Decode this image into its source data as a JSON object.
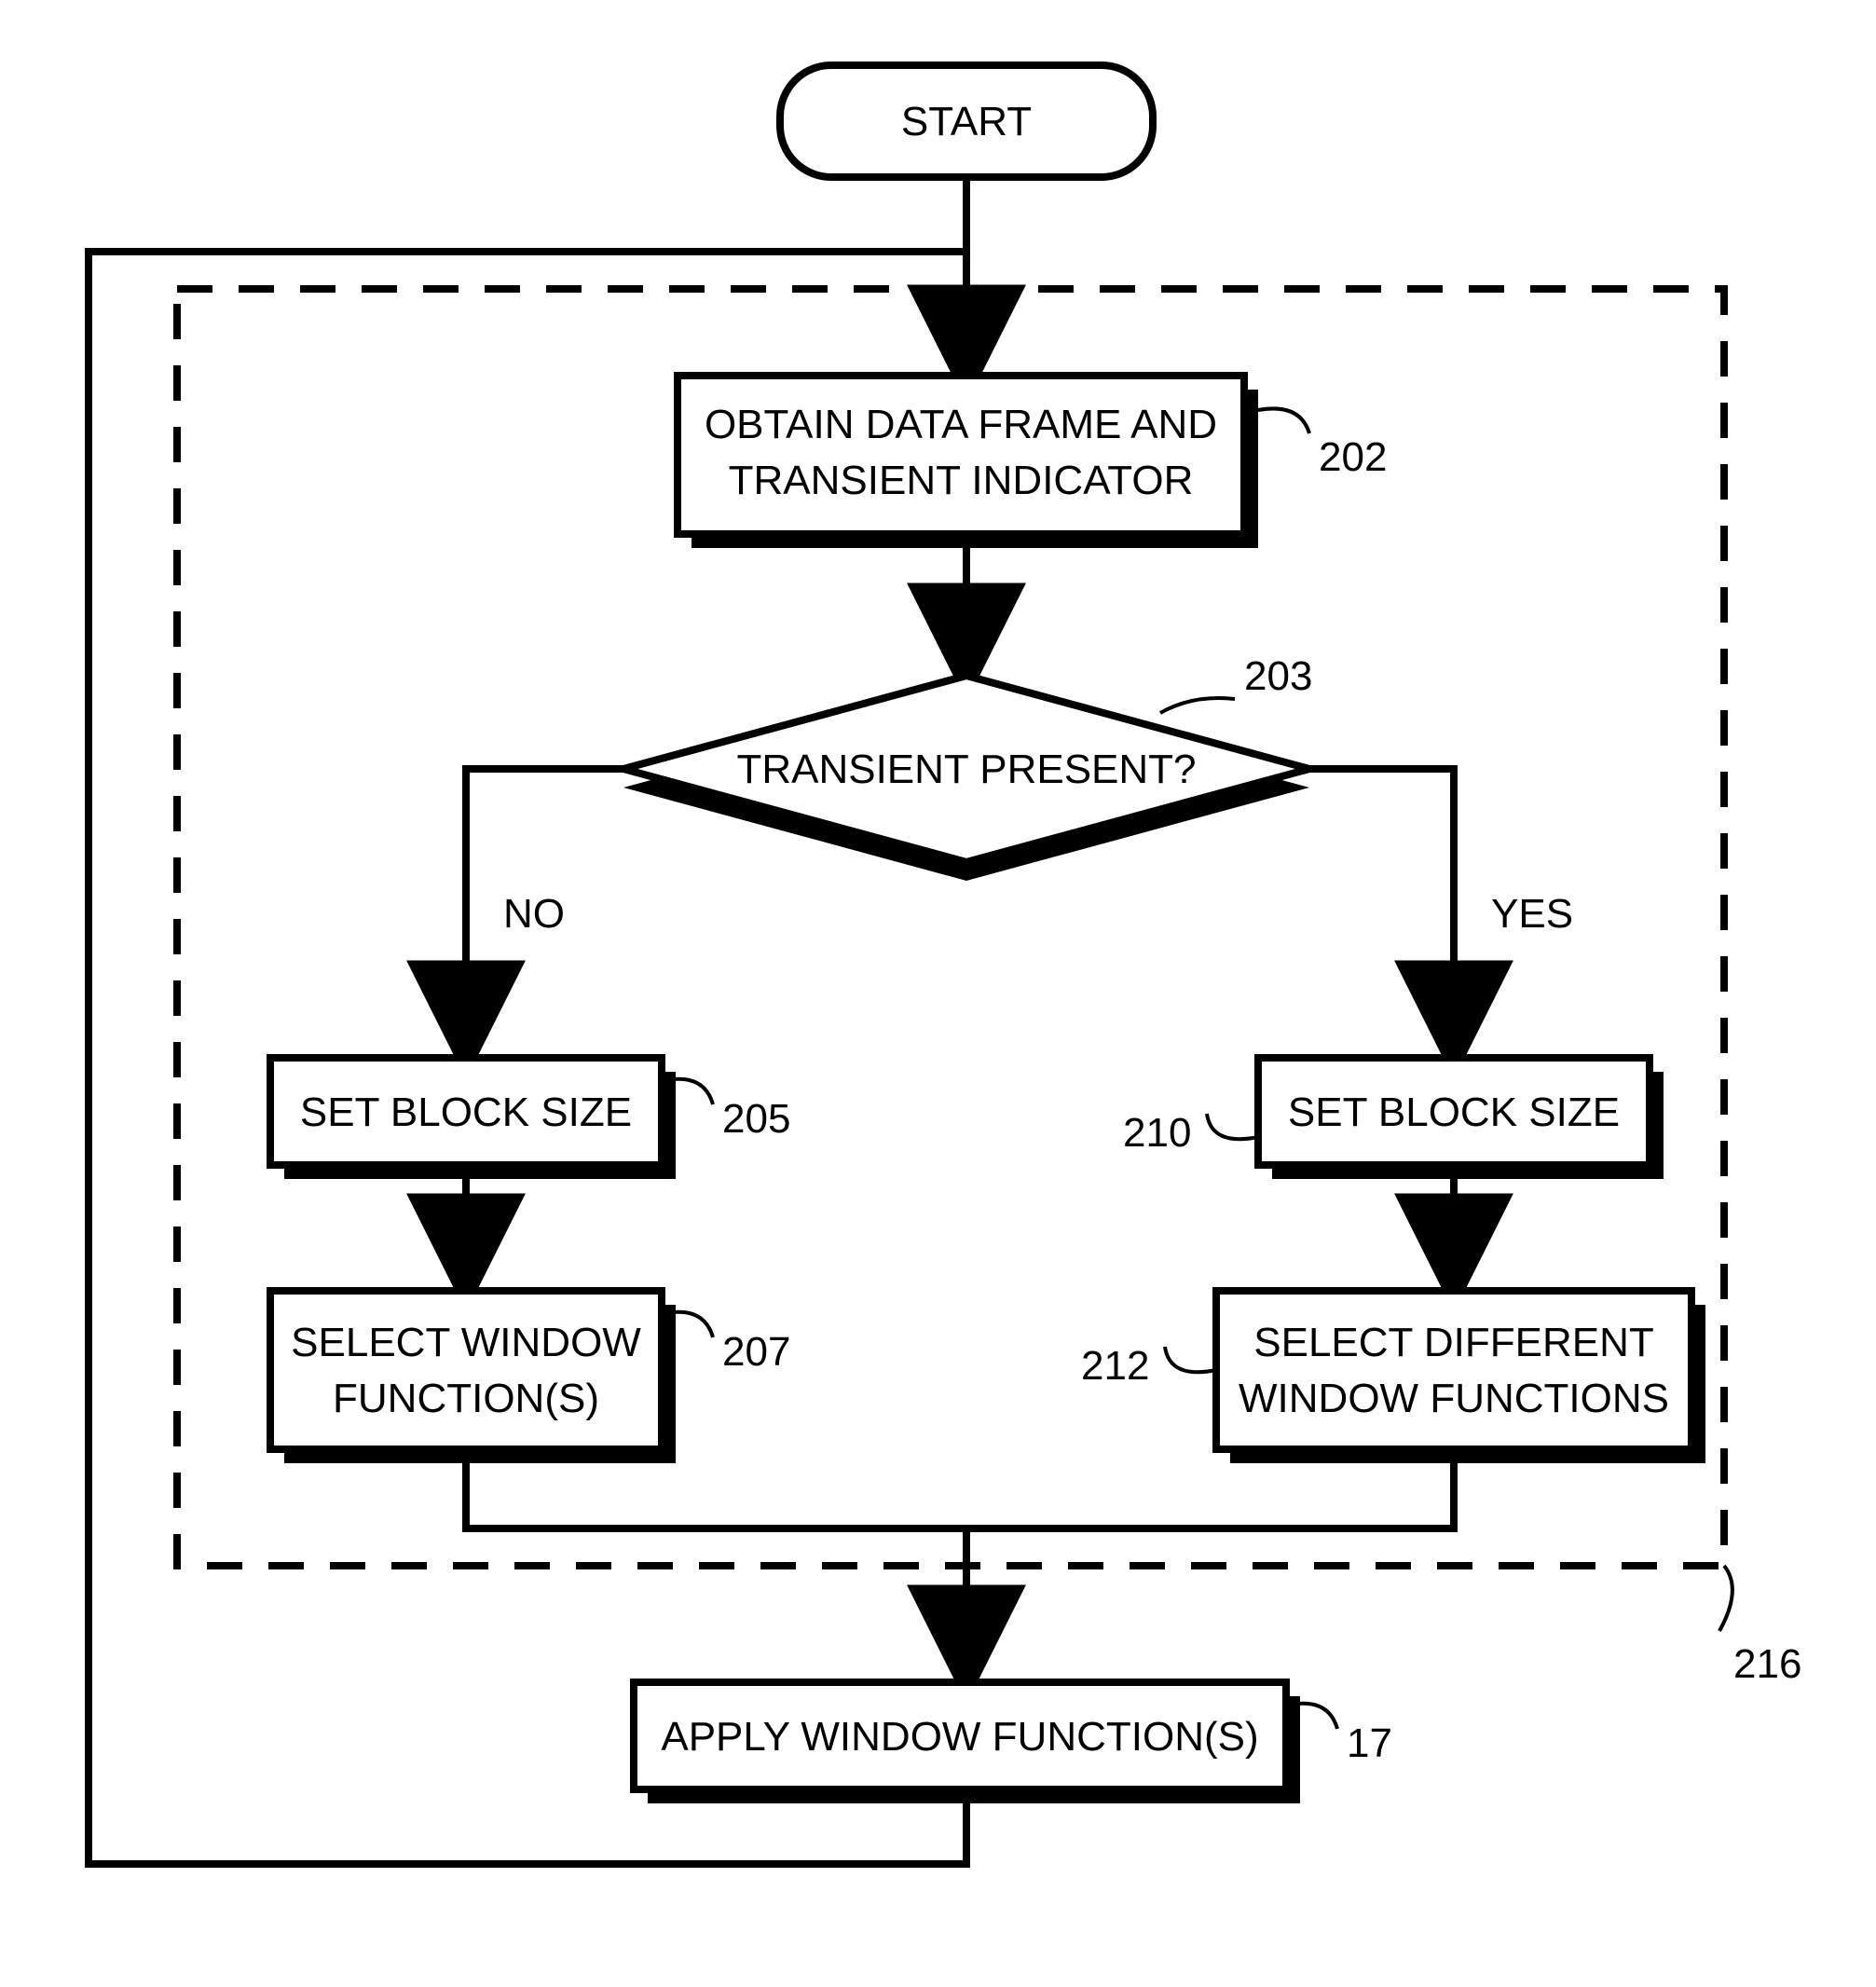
{
  "chart_data": {
    "type": "flowchart",
    "nodes": [
      {
        "id": "start",
        "shape": "terminator",
        "text": "START"
      },
      {
        "id": "n202",
        "shape": "process",
        "text_lines": [
          "OBTAIN DATA FRAME AND",
          "TRANSIENT INDICATOR"
        ],
        "label": "202"
      },
      {
        "id": "n203",
        "shape": "decision",
        "text": "TRANSIENT PRESENT?",
        "label": "203"
      },
      {
        "id": "n205",
        "shape": "process",
        "text": "SET BLOCK SIZE",
        "label": "205"
      },
      {
        "id": "n207",
        "shape": "process",
        "text_lines": [
          "SELECT WINDOW",
          "FUNCTION(S)"
        ],
        "label": "207"
      },
      {
        "id": "n210",
        "shape": "process",
        "text": "SET BLOCK SIZE",
        "label": "210"
      },
      {
        "id": "n212",
        "shape": "process",
        "text_lines": [
          "SELECT DIFFERENT",
          "WINDOW FUNCTIONS"
        ],
        "label": "212"
      },
      {
        "id": "n17",
        "shape": "process",
        "text": "APPLY WINDOW FUNCTION(S)",
        "label": "17"
      }
    ],
    "edges": [
      {
        "from": "start",
        "to": "n202"
      },
      {
        "from": "n202",
        "to": "n203"
      },
      {
        "from": "n203",
        "to": "n205",
        "label": "NO"
      },
      {
        "from": "n203",
        "to": "n210",
        "label": "YES"
      },
      {
        "from": "n205",
        "to": "n207"
      },
      {
        "from": "n210",
        "to": "n212"
      },
      {
        "from": "n207",
        "to": "n17"
      },
      {
        "from": "n212",
        "to": "n17"
      },
      {
        "from": "n17",
        "to": "n202",
        "note": "loop back"
      }
    ],
    "group": {
      "label": "216",
      "members": [
        "n202",
        "n203",
        "n205",
        "n207",
        "n210",
        "n212"
      ],
      "style": "dashed"
    }
  },
  "labels": {
    "start": "START",
    "n202a": "OBTAIN DATA FRAME AND",
    "n202b": "TRANSIENT INDICATOR",
    "ref202": "202",
    "n203": "TRANSIENT PRESENT?",
    "ref203": "203",
    "no": "NO",
    "yes": "YES",
    "n205": "SET BLOCK SIZE",
    "ref205": "205",
    "n207a": "SELECT WINDOW",
    "n207b": "FUNCTION(S)",
    "ref207": "207",
    "n210": "SET BLOCK SIZE",
    "ref210": "210",
    "n212a": "SELECT DIFFERENT",
    "n212b": "WINDOW FUNCTIONS",
    "ref212": "212",
    "n17": "APPLY WINDOW FUNCTION(S)",
    "ref17": "17",
    "ref216": "216"
  }
}
